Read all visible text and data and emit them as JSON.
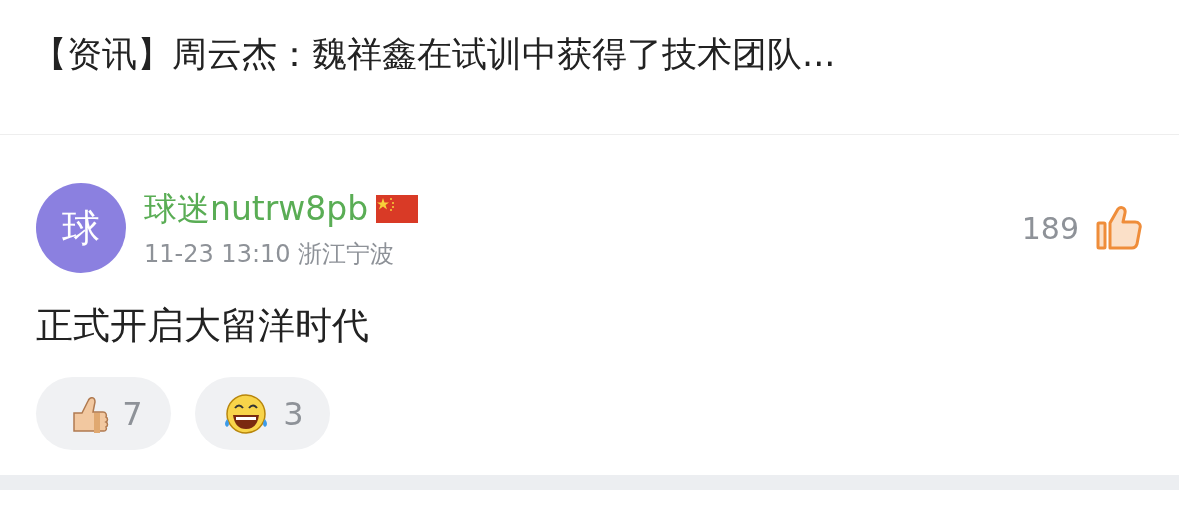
{
  "article": {
    "title": "【资讯】周云杰：魏祥鑫在试训中获得了技术团队..."
  },
  "comment": {
    "avatar_text": "球",
    "username": "球迷nutrw8pb",
    "meta": "11-23 13:10 浙江宁波",
    "like_count": "189",
    "liked": true,
    "text": "正式开启大留洋时代",
    "reactions": [
      {
        "kind": "thumbs",
        "count": "7"
      },
      {
        "kind": "laugh",
        "count": "3"
      }
    ]
  }
}
